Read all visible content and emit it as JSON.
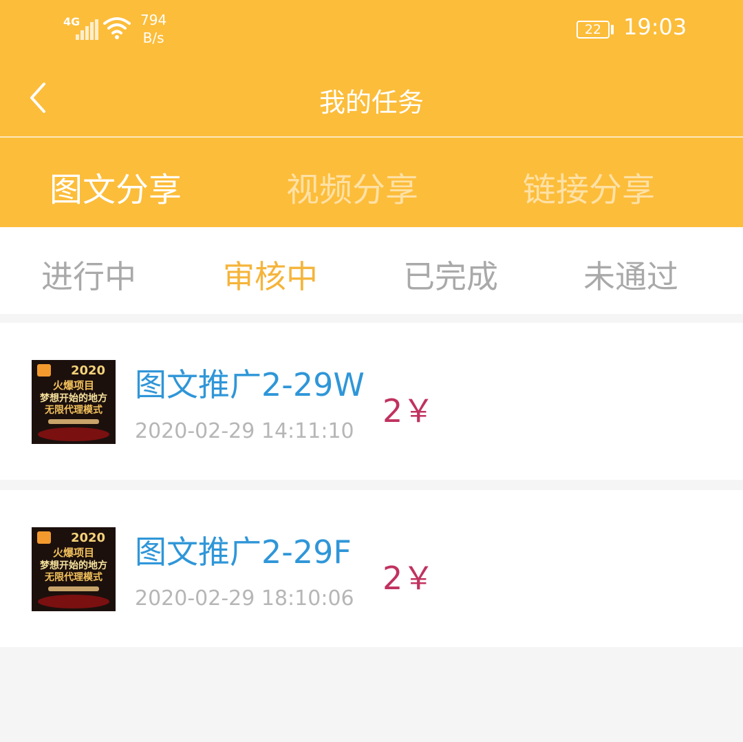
{
  "status_bar": {
    "network": "4G",
    "speed_value": "794",
    "speed_unit": "B/s",
    "battery": "22",
    "time": "19:03"
  },
  "nav": {
    "title": "我的任务",
    "back_icon": "chevron-left-icon"
  },
  "type_tabs": [
    {
      "label": "图文分享",
      "active": true
    },
    {
      "label": "视频分享",
      "active": false
    },
    {
      "label": "链接分享",
      "active": false
    }
  ],
  "status_tabs": [
    {
      "label": "进行中",
      "active": false
    },
    {
      "label": "审核中",
      "active": true
    },
    {
      "label": "已完成",
      "active": false
    },
    {
      "label": "未通过",
      "active": false
    }
  ],
  "tasks": [
    {
      "name": "图文推广2-29W",
      "time": "2020-02-29 14:11:10",
      "price": "2￥",
      "thumb": {
        "year": "2020",
        "line1": "火爆项目",
        "line2": "梦想开始的地方",
        "line3": "无限代理模式"
      }
    },
    {
      "name": "图文推广2-29F",
      "time": "2020-02-29 18:10:06",
      "price": "2￥",
      "thumb": {
        "year": "2020",
        "line1": "火爆项目",
        "line2": "梦想开始的地方",
        "line3": "无限代理模式"
      }
    }
  ],
  "colors": {
    "header": "#fcbd3a",
    "active_status_tab": "#f5b43a",
    "task_name": "#2f96d8",
    "price": "#c0325f",
    "muted": "#a9a9a9"
  }
}
